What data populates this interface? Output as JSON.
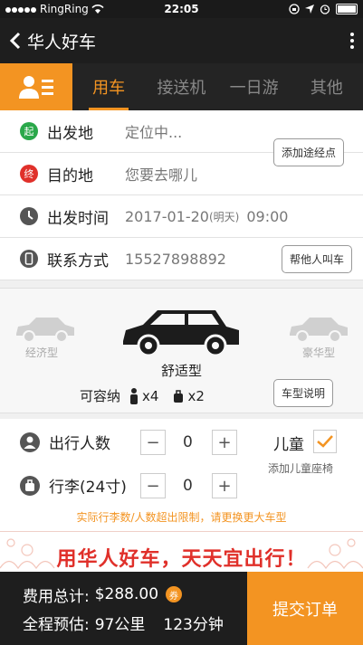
{
  "status_bar": {
    "carrier": "RingRing",
    "time": "22:05"
  },
  "nav": {
    "title": "华人好车"
  },
  "tabs": [
    {
      "label": "用车",
      "active": true
    },
    {
      "label": "接送机",
      "active": false
    },
    {
      "label": "一日游",
      "active": false
    },
    {
      "label": "其他",
      "active": false
    }
  ],
  "form": {
    "origin": {
      "badge": "起",
      "label": "出发地",
      "value": "定位中..."
    },
    "add_stop_label": "添加途经点",
    "destination": {
      "badge": "终",
      "label": "目的地",
      "value": "您要去哪儿"
    },
    "depart_time": {
      "label": "出发时间",
      "value": "2017-01-20",
      "day_note": "(明天)",
      "clock": "09:00"
    },
    "contact": {
      "label": "联系方式",
      "value": "15527898892"
    },
    "call_for_others_label": "帮他人叫车"
  },
  "car_types": {
    "left": "经济型",
    "center": "舒适型",
    "right": "豪华型",
    "capacity_label": "可容纳",
    "persons": "x4",
    "bags": "x2",
    "explain_label": "车型说明"
  },
  "passengers": {
    "people_label": "出行人数",
    "people_value": "0",
    "luggage_label": "行李(24寸)",
    "luggage_value": "0",
    "child_label": "儿童",
    "child_seat_label": "添加儿童座椅",
    "warning": "实际行李数/人数超出限制，请更换更大车型"
  },
  "banner": {
    "slogan": "用华人好车，天天宜出行！"
  },
  "footer": {
    "cost_label": "费用总计:",
    "cost_value": "$288.00",
    "coupon_badge": "券",
    "estimate_label": "全程预估:",
    "distance": "97公里",
    "duration": "123分钟",
    "submit_label": "提交订单"
  },
  "colors": {
    "accent": "#f39422",
    "dark": "#1e1e1e",
    "origin_green": "#2aa84a",
    "dest_red": "#e0302a"
  }
}
